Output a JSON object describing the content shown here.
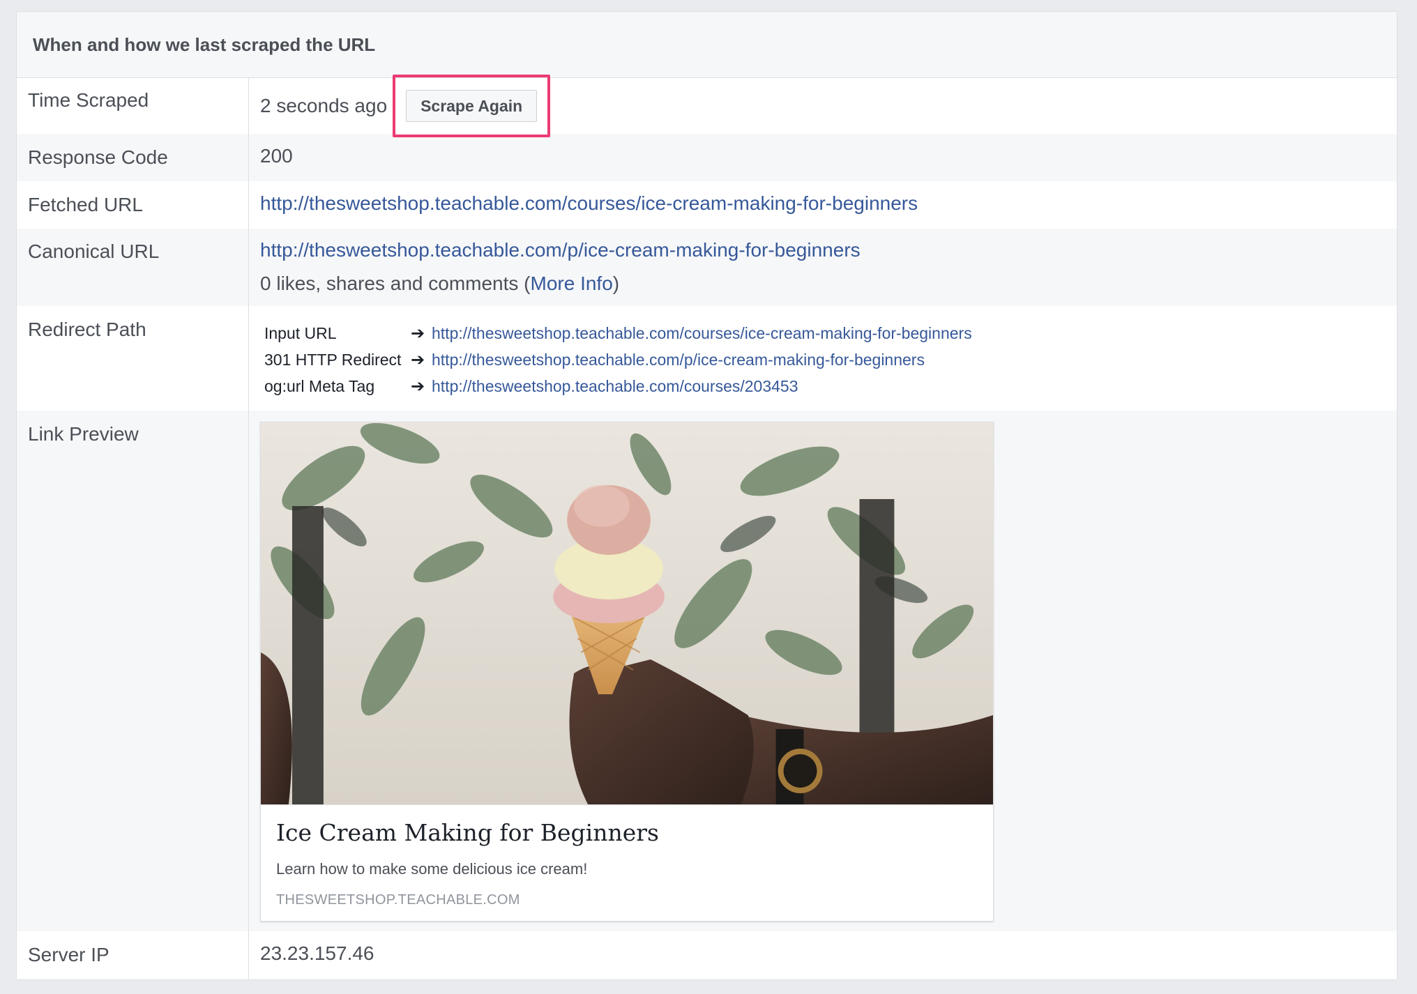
{
  "header": {
    "title": "When and how we last scraped the URL"
  },
  "rows": {
    "time_scraped": {
      "label": "Time Scraped",
      "value": "2 seconds ago",
      "button": "Scrape Again"
    },
    "response_code": {
      "label": "Response Code",
      "value": "200"
    },
    "fetched_url": {
      "label": "Fetched URL",
      "value": "http://thesweetshop.teachable.com/courses/ice-cream-making-for-beginners"
    },
    "canonical_url": {
      "label": "Canonical URL",
      "value": "http://thesweetshop.teachable.com/p/ice-cream-making-for-beginners",
      "engagement_prefix": "0 likes, shares and comments (",
      "more_info": "More Info",
      "engagement_suffix": ")"
    },
    "redirect_path": {
      "label": "Redirect Path",
      "items": [
        {
          "type": "Input URL",
          "url": "http://thesweetshop.teachable.com/courses/ice-cream-making-for-beginners"
        },
        {
          "type": "301 HTTP Redirect",
          "url": "http://thesweetshop.teachable.com/p/ice-cream-making-for-beginners"
        },
        {
          "type": "og:url Meta Tag",
          "url": "http://thesweetshop.teachable.com/courses/203453"
        }
      ],
      "arrow": "➔"
    },
    "link_preview": {
      "label": "Link Preview",
      "title": "Ice Cream Making for Beginners",
      "description": "Learn how to make some delicious ice cream!",
      "domain": "THESWEETSHOP.TEACHABLE.COM"
    },
    "server_ip": {
      "label": "Server IP",
      "value": "23.23.157.46"
    }
  },
  "colors": {
    "link": "#365899",
    "highlight": "#ec3b73",
    "background": "#e9ebee",
    "alt_row": "#f6f7f9"
  }
}
